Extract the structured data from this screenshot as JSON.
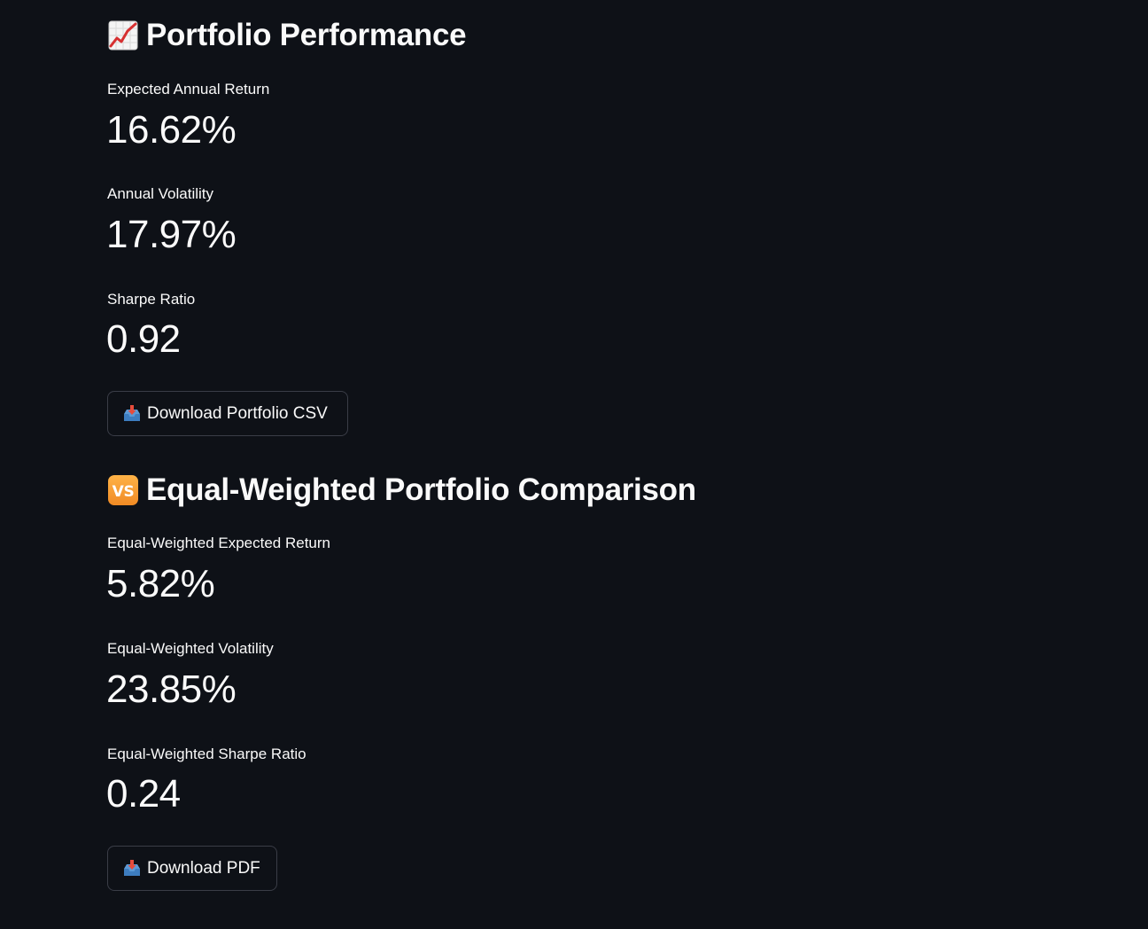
{
  "sections": {
    "optimized": {
      "title": "Portfolio Performance",
      "icon": "chart-increasing-icon",
      "metrics": [
        {
          "label": "Expected Annual Return",
          "value": "16.62%"
        },
        {
          "label": "Annual Volatility",
          "value": "17.97%"
        },
        {
          "label": "Sharpe Ratio",
          "value": "0.92"
        }
      ],
      "download_label": "Download Portfolio CSV",
      "download_icon": "inbox-tray-icon"
    },
    "equal_weighted": {
      "title": "Equal-Weighted Portfolio Comparison",
      "icon": "vs-icon",
      "icon_text": "VS",
      "metrics": [
        {
          "label": "Equal-Weighted Expected Return",
          "value": "5.82%"
        },
        {
          "label": "Equal-Weighted Volatility",
          "value": "23.85%"
        },
        {
          "label": "Equal-Weighted Sharpe Ratio",
          "value": "0.24"
        }
      ],
      "download_label": "Download PDF",
      "download_icon": "inbox-tray-icon"
    }
  },
  "colors": {
    "background": "#0e1117",
    "text": "#fafafa",
    "button_border": "#3a3d47",
    "vs_badge": "#f5a623",
    "chart_line": "#d63031"
  }
}
